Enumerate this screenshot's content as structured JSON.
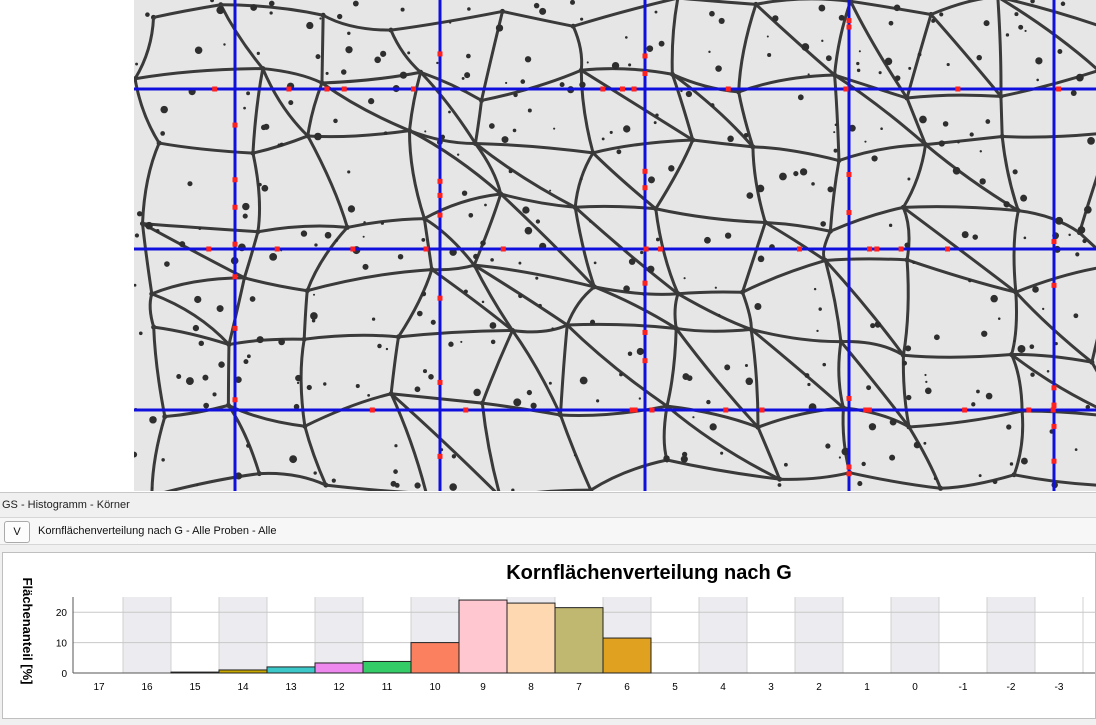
{
  "micrograph": {
    "description_icon": "grain-structure-micrograph",
    "grid_color": "#1010dd",
    "marker_color": "#ff2020"
  },
  "panel": {
    "title": "GS - Histogramm - Körner",
    "toolbar_button": "V",
    "view_label": "Kornflächenverteilung nach G - Alle Proben - Alle"
  },
  "chart_data": {
    "type": "bar",
    "title": "Kornflächenverteilung nach G",
    "ylabel": "Flächenanteil [%]",
    "xlabel": "",
    "ylim": [
      0,
      25
    ],
    "yticks": [
      "0",
      "10",
      "20"
    ],
    "grid": true,
    "categories": [
      "17",
      "16",
      "15",
      "14",
      "13",
      "12",
      "11",
      "10",
      "9",
      "8",
      "7",
      "6",
      "5",
      "4",
      "3",
      "2",
      "1",
      "0",
      "-1",
      "-2",
      "-3"
    ],
    "values": [
      0,
      0,
      0.3,
      1,
      2,
      3.3,
      3.8,
      10,
      24,
      23,
      21.5,
      11.5,
      0,
      0,
      0,
      0,
      0,
      0,
      0,
      0,
      0
    ],
    "colors": [
      "#888888",
      "#888888",
      "#b0b0b0",
      "#c8a800",
      "#3cc8c8",
      "#ee88ee",
      "#33cc66",
      "#fa8060",
      "#ffc8d0",
      "#fed8b0",
      "#c0b870",
      "#e0a020",
      "#888888",
      "#888888",
      "#888888",
      "#888888",
      "#888888",
      "#888888",
      "#888888",
      "#888888",
      "#888888"
    ]
  }
}
